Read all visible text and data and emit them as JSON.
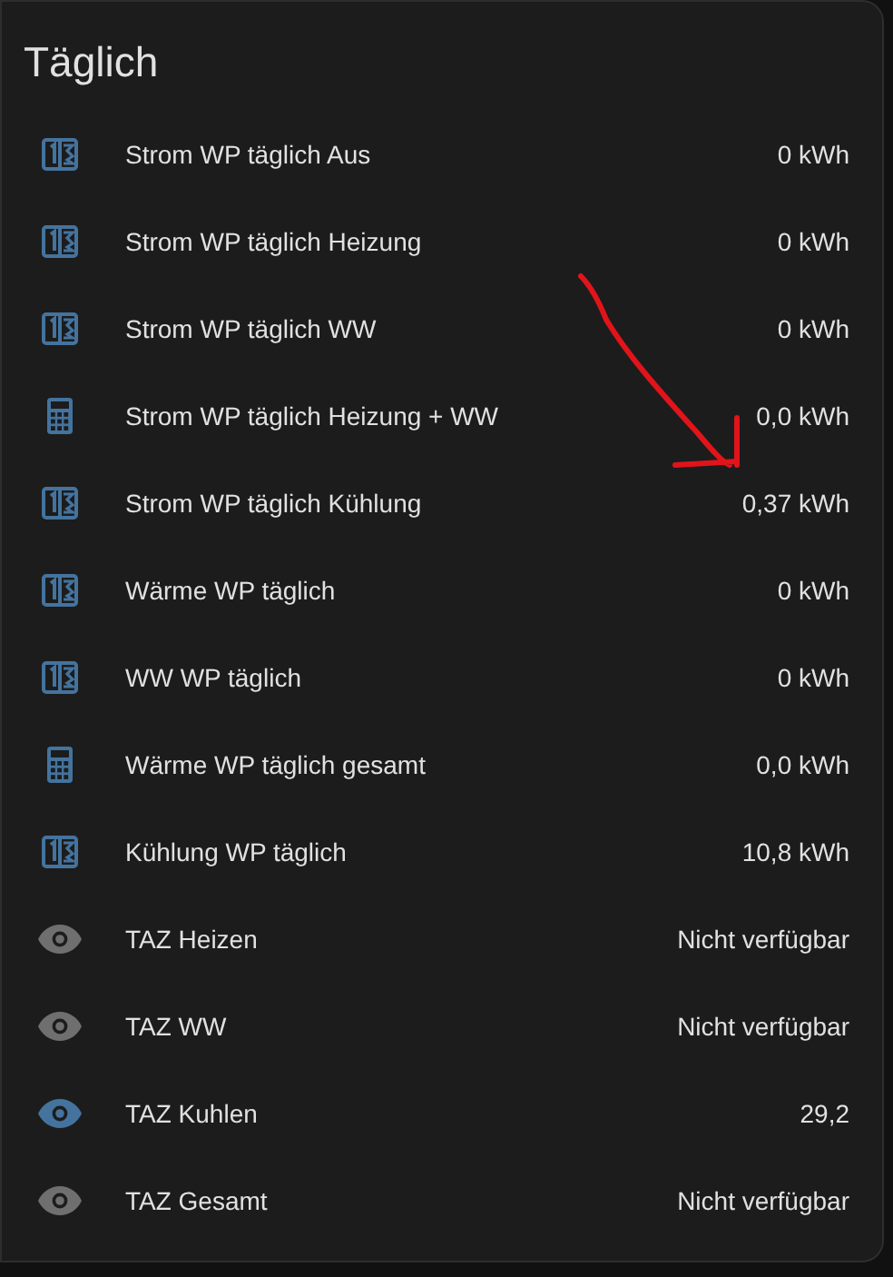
{
  "card": {
    "title": "Täglich",
    "rows": [
      {
        "kind": "counter",
        "name": "Strom WP täglich Aus",
        "value": "0 kWh"
      },
      {
        "kind": "counter",
        "name": "Strom WP täglich Heizung",
        "value": "0 kWh"
      },
      {
        "kind": "counter",
        "name": "Strom WP täglich WW",
        "value": "0 kWh"
      },
      {
        "kind": "calculator",
        "name": "Strom WP täglich Heizung + WW",
        "value": "0,0 kWh"
      },
      {
        "kind": "counter",
        "name": "Strom WP täglich Kühlung",
        "value": "0,37 kWh"
      },
      {
        "kind": "counter",
        "name": "Wärme WP täglich",
        "value": "0 kWh"
      },
      {
        "kind": "counter",
        "name": "WW WP täglich",
        "value": "0 kWh"
      },
      {
        "kind": "calculator",
        "name": "Wärme WP täglich gesamt",
        "value": "0,0 kWh"
      },
      {
        "kind": "counter",
        "name": "Kühlung WP täglich",
        "value": "10,8 kWh"
      },
      {
        "kind": "eye",
        "active": false,
        "name": "TAZ Heizen",
        "value": "Nicht verfügbar"
      },
      {
        "kind": "eye",
        "active": false,
        "name": "TAZ WW",
        "value": "Nicht verfügbar"
      },
      {
        "kind": "eye",
        "active": true,
        "name": "TAZ Kuhlen",
        "value": "29,2"
      },
      {
        "kind": "eye",
        "active": false,
        "name": "TAZ Gesamt",
        "value": "Nicht verfügbar"
      }
    ]
  }
}
